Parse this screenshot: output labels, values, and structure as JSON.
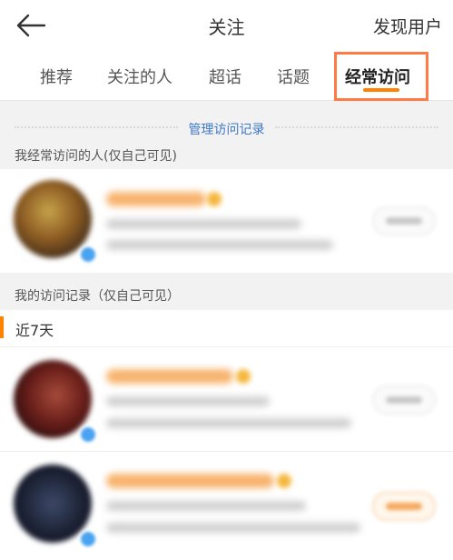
{
  "header": {
    "title": "关注",
    "discover_label": "发现用户"
  },
  "tabs": [
    {
      "label": "推荐"
    },
    {
      "label": "关注的人"
    },
    {
      "label": "超话"
    },
    {
      "label": "话题"
    },
    {
      "label": "经常访问",
      "active": true
    }
  ],
  "manage_link": "管理访问记录",
  "frequent_section": {
    "title": "我经常访问的人(仅自己可见)"
  },
  "history_section": {
    "title": "我的访问记录（仅自己可见）",
    "period": "近7天"
  },
  "colors": {
    "accent": "#ff8200",
    "highlight_box": "#ff7a45",
    "link": "#3d78c7"
  },
  "icons": [
    "back-arrow-icon",
    "verified-badge-icon",
    "crown-icon"
  ]
}
